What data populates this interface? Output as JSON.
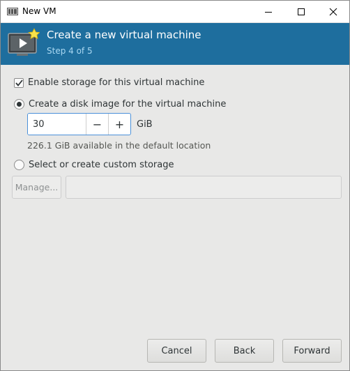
{
  "window": {
    "title": "New VM",
    "icons": {
      "app": "vm-manager-icon",
      "minimize": "minimize-icon",
      "maximize": "maximize-icon",
      "close": "close-icon"
    }
  },
  "header": {
    "title": "Create a new virtual machine",
    "step": "Step 4 of 5",
    "icon": "vm-screen-star-icon",
    "background": "#1e6e9e"
  },
  "storage": {
    "enable_label": "Enable storage for this virtual machine",
    "enable_checked": true,
    "create_disk_label": "Create a disk image for the virtual machine",
    "create_disk_selected": true,
    "disk_size_value": "30",
    "disk_size_unit": "GiB",
    "decrement_symbol": "−",
    "increment_symbol": "+",
    "available_text": "226.1 GiB available in the default location",
    "custom_label": "Select or create custom storage",
    "custom_selected": false,
    "manage_label": "Manage...",
    "custom_path_value": ""
  },
  "footer": {
    "cancel_label": "Cancel",
    "back_label": "Back",
    "forward_label": "Forward"
  }
}
